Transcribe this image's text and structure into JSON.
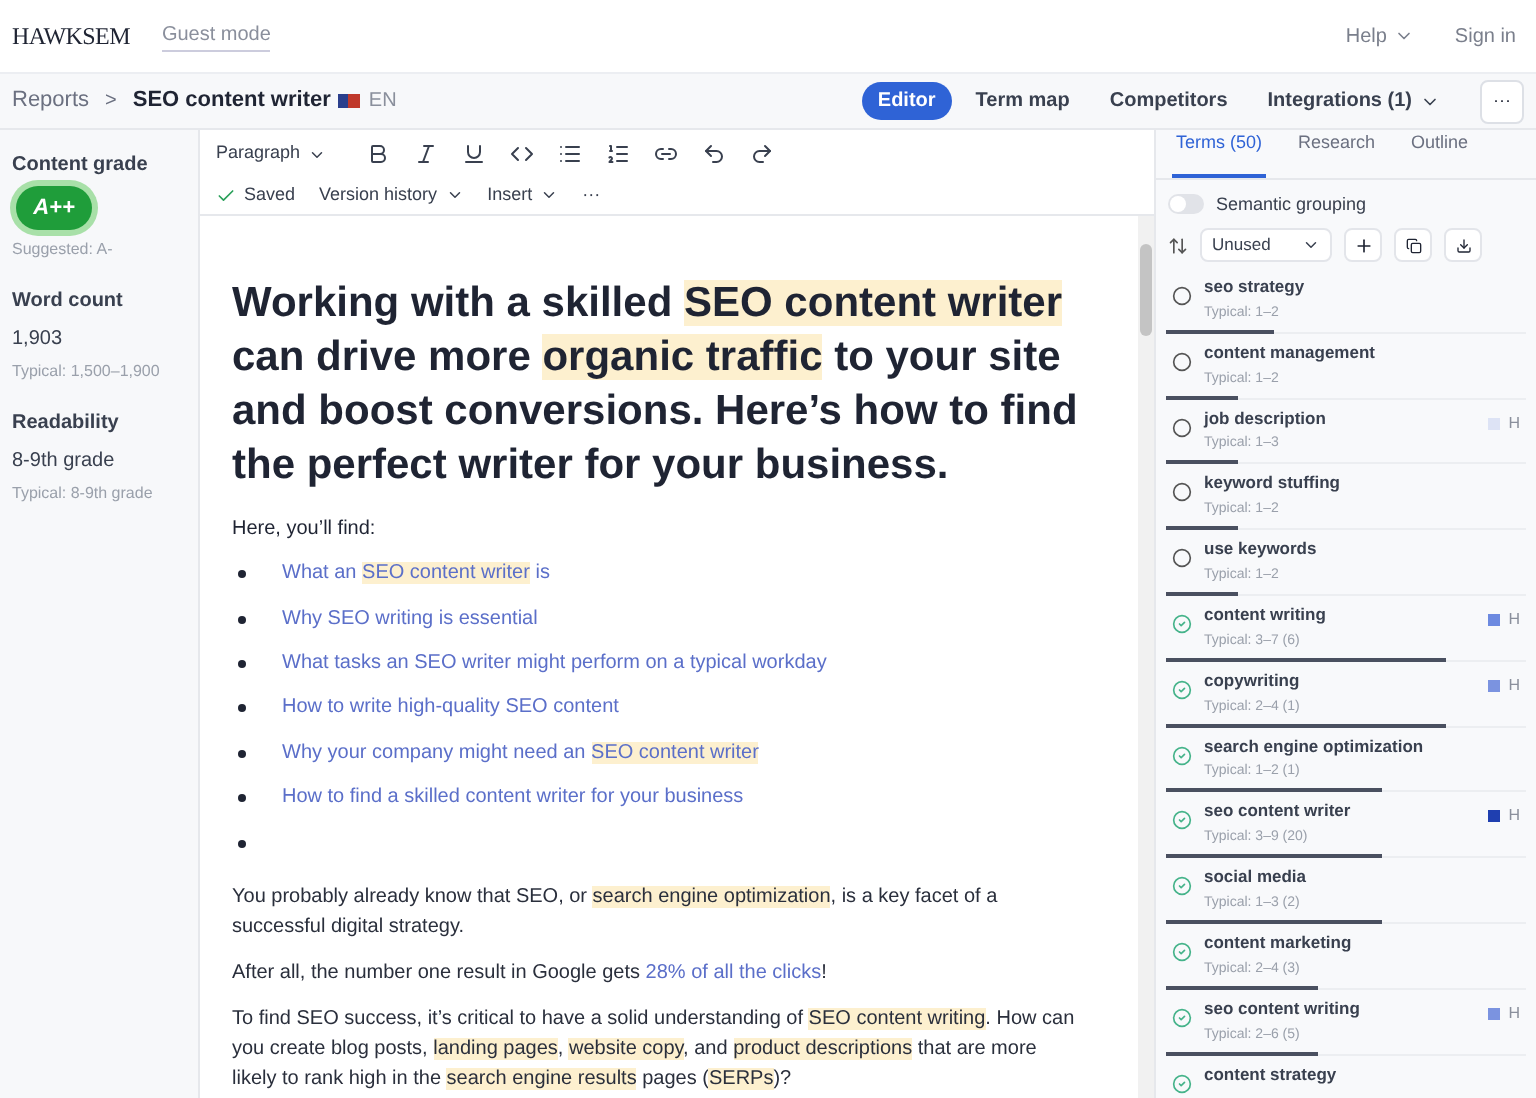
{
  "topbar": {
    "logo": "HAWKSEM",
    "mode": "Guest mode",
    "help": "Help",
    "sign_in": "Sign in"
  },
  "header": {
    "breadcrumb": "Reports",
    "separator": ">",
    "title": "SEO content writer",
    "language": "EN",
    "nav": [
      {
        "label": "Editor",
        "selected": true
      },
      {
        "label": "Term map",
        "selected": false
      },
      {
        "label": "Competitors",
        "selected": false
      },
      {
        "label": "Integrations (1)",
        "selected": false
      }
    ],
    "more": "···"
  },
  "stats": {
    "grade_label": "Content grade",
    "grade": "A++",
    "suggested": "Suggested: A-",
    "word_count_label": "Word count",
    "word_count": "1,903",
    "word_count_typical": "Typical: 1,500–1,900",
    "readability_label": "Readability",
    "readability": "8-9th grade",
    "readability_typical": "Typical: 8-9th grade"
  },
  "toolbar": {
    "block_type": "Paragraph",
    "saved": "Saved",
    "version_history": "Version history",
    "insert": "Insert",
    "more": "···"
  },
  "document": {
    "heading": [
      {
        "text": "Working with a skilled "
      },
      {
        "text": "SEO content writer",
        "highlighted": true
      },
      {
        "text": " can drive more "
      },
      {
        "text": "organic traffic",
        "highlighted": true
      },
      {
        "text": " to your site and boost conversions. Here’s how to find the perfect writer for your business."
      }
    ],
    "intro": "Here, you’ll find:",
    "bullets": [
      [
        {
          "text": "What an "
        },
        {
          "text": "SEO content writer",
          "highlighted": true
        },
        {
          "text": " is"
        }
      ],
      [
        {
          "text": "Why SEO writing is essential"
        }
      ],
      [
        {
          "text": "What tasks an SEO writer might perform on a typical workday"
        }
      ],
      [
        {
          "text": "How to write high-quality SEO content"
        }
      ],
      [
        {
          "text": "Why your company might need an "
        },
        {
          "text": "SEO content writer",
          "highlighted": true
        }
      ],
      [
        {
          "text": "How to find a skilled content writer for your business"
        }
      ]
    ],
    "blank_bullet": true,
    "paragraphs": [
      [
        {
          "text": "You probably already know that SEO, or "
        },
        {
          "text": "search engine optimization",
          "highlighted": true
        },
        {
          "text": ", is a key facet of a successful digital strategy."
        }
      ],
      [
        {
          "text": "After all, the number one result in Google gets "
        },
        {
          "text": "28% of all the clicks",
          "link": true
        },
        {
          "text": "!"
        }
      ],
      [
        {
          "text": "To find SEO success, it’s critical to have a solid understanding of "
        },
        {
          "text": "SEO content writing",
          "highlighted": true
        },
        {
          "text": ". How can you create blog posts, "
        },
        {
          "text": "landing pages",
          "highlighted": true
        },
        {
          "text": ", "
        },
        {
          "text": "website copy",
          "highlighted": true
        },
        {
          "text": ", and "
        },
        {
          "text": "product descriptions",
          "highlighted": true
        },
        {
          "text": " that are more likely to rank high in the "
        },
        {
          "text": "search engine results",
          "highlighted": true
        },
        {
          "text": " pages ("
        },
        {
          "text": "SERPs",
          "highlighted": true
        },
        {
          "text": ")?"
        }
      ]
    ]
  },
  "sidebar": {
    "tabs": [
      {
        "label": "Terms (50)",
        "selected": true
      },
      {
        "label": "Research",
        "selected": false
      },
      {
        "label": "Outline",
        "selected": false
      }
    ],
    "semantic_grouping": {
      "label": "Semantic grouping",
      "on": false
    },
    "filter": "Unused",
    "terms": [
      {
        "name": "seo strategy",
        "typical": "Typical: 1–2",
        "used": false,
        "level": 0.3
      },
      {
        "name": "content management",
        "typical": "Typical: 1–2",
        "used": false,
        "level": 0.2
      },
      {
        "name": "job description",
        "typical": "Typical: 1–3",
        "used": false,
        "level": 0.2,
        "marker": "H",
        "color": "#dde3f5"
      },
      {
        "name": "keyword stuffing",
        "typical": "Typical: 1–2",
        "used": false,
        "level": 0.2
      },
      {
        "name": "use keywords",
        "typical": "Typical: 1–2",
        "used": false,
        "level": 0.2
      },
      {
        "name": "content writing",
        "typical": "Typical: 3–7 (6)",
        "used": true,
        "level": 0.78,
        "marker": "H",
        "color": "#6d8ae0"
      },
      {
        "name": "copywriting",
        "typical": "Typical: 2–4 (1)",
        "used": true,
        "level": 0.78,
        "marker": "H",
        "color": "#7b93e0"
      },
      {
        "name": "search engine optimization",
        "typical": "Typical: 1–2 (1)",
        "used": true,
        "level": 0.6
      },
      {
        "name": "seo content writer",
        "typical": "Typical: 3–9 (20)",
        "used": true,
        "level": 0.6,
        "marker": "H",
        "color": "#1f3fb0"
      },
      {
        "name": "social media",
        "typical": "Typical: 1–3 (2)",
        "used": true,
        "level": 0.6
      },
      {
        "name": "content marketing",
        "typical": "Typical: 2–4 (3)",
        "used": true,
        "level": 0.42
      },
      {
        "name": "seo content writing",
        "typical": "Typical: 2–6 (5)",
        "used": true,
        "level": 0.42,
        "marker": "H",
        "color": "#7b93e0"
      },
      {
        "name": "content strategy",
        "used": true
      }
    ]
  }
}
